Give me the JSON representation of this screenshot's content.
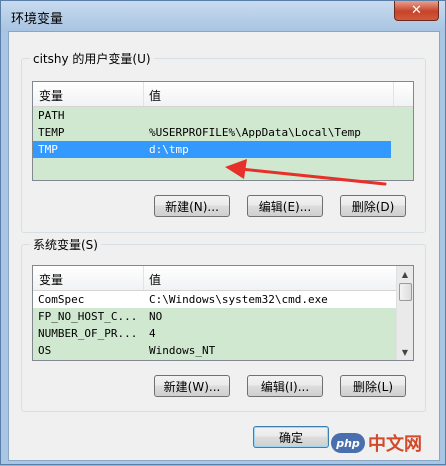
{
  "window": {
    "title": "环境变量",
    "close_glyph": "✕"
  },
  "user_vars": {
    "group_label": "citshy 的用户变量(U)",
    "columns": [
      "变量",
      "值"
    ],
    "rows": [
      {
        "name": "PATH",
        "value": ""
      },
      {
        "name": "TEMP",
        "value": "%USERPROFILE%\\AppData\\Local\\Temp"
      },
      {
        "name": "TMP",
        "value": "d:\\tmp"
      }
    ],
    "selected_row": "TMP",
    "buttons": {
      "new": "新建(N)...",
      "edit": "编辑(E)...",
      "delete": "删除(D)"
    }
  },
  "system_vars": {
    "group_label": "系统变量(S)",
    "columns": [
      "变量",
      "值"
    ],
    "rows": [
      {
        "name": "ComSpec",
        "value": "C:\\Windows\\system32\\cmd.exe"
      },
      {
        "name": "FP_NO_HOST_C...",
        "value": "NO"
      },
      {
        "name": "NUMBER_OF_PR...",
        "value": "4"
      },
      {
        "name": "OS",
        "value": "Windows_NT"
      }
    ],
    "buttons": {
      "new": "新建(W)...",
      "edit": "编辑(I)...",
      "delete": "删除(L)"
    }
  },
  "footer": {
    "ok": "确定"
  },
  "watermark": {
    "logo": "php",
    "text": "中文网"
  },
  "colors": {
    "list_bg": "#cfe8cf",
    "selection": "#3399ff",
    "annotation_arrow": "#e8302a"
  },
  "icons": [
    "close-icon",
    "scroll-up-icon",
    "scroll-down-icon",
    "red-arrow-annotation"
  ]
}
